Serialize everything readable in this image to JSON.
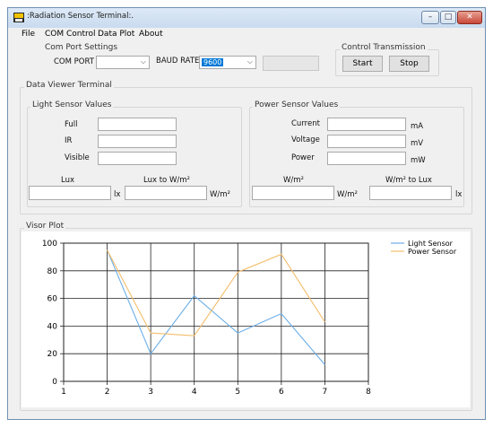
{
  "window": {
    "title": ":Radiation Sensor Terminal:.",
    "min": "–",
    "max": "□",
    "close": "✕"
  },
  "menu": {
    "file": "File",
    "com_control": "COM Control",
    "data_plot": "Data Plot",
    "about": "About"
  },
  "com_port": {
    "group_title": "Com Port Settings",
    "port_label": "COM PORT",
    "port_value": "",
    "baud_label": "BAUD RATE",
    "baud_value": "9600"
  },
  "control": {
    "group_title": "Control Transmission",
    "start": "Start",
    "stop": "Stop"
  },
  "viewer": {
    "title": "Data Viewer Terminal"
  },
  "light": {
    "title": "Light Sensor Values",
    "full_label": "Full",
    "ir_label": "IR",
    "visible_label": "Visible",
    "full": "",
    "ir": "",
    "visible": "",
    "lux_label": "Lux",
    "lux_value": "",
    "lux_unit": "lx",
    "lux_to_w_label": "Lux to W/m²",
    "lux_to_w_value": "",
    "lux_to_w_unit": "W/m²"
  },
  "power": {
    "title": "Power Sensor Values",
    "current_label": "Current",
    "voltage_label": "Voltage",
    "power_label": "Power",
    "current": "",
    "voltage": "",
    "power": "",
    "current_unit": "mA",
    "voltage_unit": "mV",
    "power_unit": "mW",
    "wm_label": "W/m²",
    "wm_value": "",
    "wm_unit": "W/m²",
    "wm_to_lux_label": "W/m² to Lux",
    "wm_to_lux_value": "",
    "wm_to_lux_unit": "lx"
  },
  "plot": {
    "title": "Visor Plot"
  },
  "colors": {
    "light": "#6aaee8",
    "power": "#f3bd6b"
  },
  "chart_data": {
    "type": "line",
    "title": "",
    "xlabel": "",
    "ylabel": "",
    "xlim": [
      1,
      8
    ],
    "ylim": [
      0,
      100
    ],
    "xticks": [
      1,
      2,
      3,
      4,
      5,
      6,
      7,
      8
    ],
    "yticks": [
      0,
      20,
      40,
      60,
      80,
      100
    ],
    "grid": true,
    "legend": "top-right",
    "series": [
      {
        "name": "Light Sensor",
        "x": [
          2,
          3,
          4,
          5,
          6,
          7
        ],
        "y": [
          95,
          20,
          62,
          35,
          49,
          12
        ]
      },
      {
        "name": "Power Sensor",
        "x": [
          2,
          3,
          4,
          5,
          6,
          7
        ],
        "y": [
          95,
          35,
          33,
          79,
          92,
          43
        ]
      }
    ]
  }
}
